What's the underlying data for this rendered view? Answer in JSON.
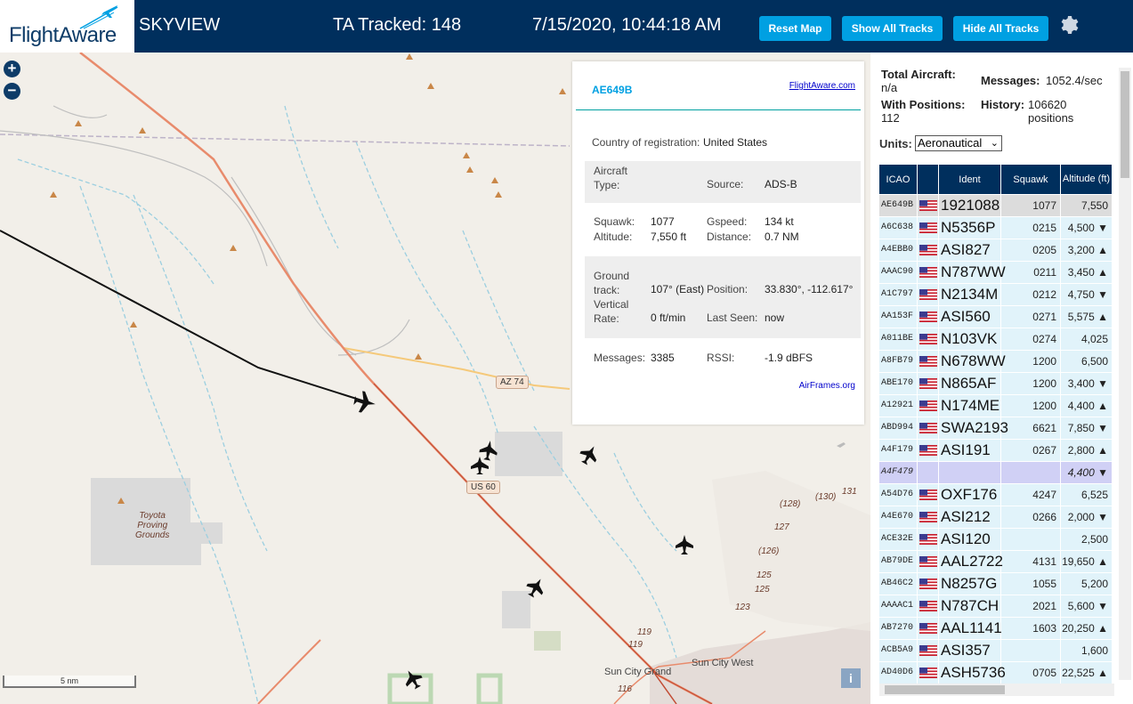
{
  "header": {
    "logo_text": "FlightAware",
    "app_name": "SKYVIEW",
    "ta_tracked": "TA Tracked: 148",
    "datetime": "7/15/2020, 10:44:18 AM",
    "buttons": {
      "reset": "Reset Map",
      "show_all": "Show All Tracks",
      "hide_all": "Hide All Tracks"
    },
    "settings_icon": "gear-icon",
    "bg_color": "#002f5d",
    "button_color": "#00a0e2"
  },
  "map": {
    "zoom_in": "+",
    "zoom_out": "−",
    "road_labels": {
      "az74": "AZ 74",
      "us60": "US 60"
    },
    "place_labels": {
      "toyota": "Toyota\nProving\nGrounds",
      "sun_city_grand": "Sun City Grand",
      "sun_city_west": "Sun City West"
    },
    "route_numbers": [
      "(128)",
      "(130)",
      "131",
      "127",
      "(126)",
      "125",
      "125",
      "123",
      "119",
      "119",
      "116"
    ],
    "scale": "5 nm",
    "info_btn": "i"
  },
  "popup": {
    "hex": "AE649B",
    "fa_link": "FlightAware.com",
    "country_label": "Country of registration:",
    "country": "United States",
    "aircraft_type_label": "Aircraft\nType:",
    "source_label": "Source:",
    "source": "ADS-B",
    "squawk_label": "Squawk:",
    "squawk": "1077",
    "gspeed_label": "Gspeed:",
    "gspeed": "134 kt",
    "altitude_label": "Altitude:",
    "altitude": "7,550 ft",
    "distance_label": "Distance:",
    "distance": "0.7 NM",
    "track_label": "Ground\ntrack:",
    "track": "107° (East)",
    "position_label": "Position:",
    "position": "33.830°, -112.617°",
    "vrate_label": "Vertical\nRate:",
    "vrate": "0 ft/min",
    "lastseen_label": "Last Seen:",
    "lastseen": "now",
    "messages_label": "Messages:",
    "messages": "3385",
    "rssi_label": "RSSI:",
    "rssi": "-1.9 dBFS",
    "airframes": "AirFrames.org"
  },
  "sidebar": {
    "total_label": "Total Aircraft:",
    "total": "n/a",
    "messages_label": "Messages:",
    "messages": "1052.4/sec",
    "withpos_label": "With Positions:",
    "withpos": "112",
    "history_label": "History:",
    "history": "106620 positions",
    "units_label": "Units:",
    "units_value": "Aeronautical",
    "columns": {
      "icao": "ICAO",
      "ident": "Ident",
      "squawk": "Squawk",
      "altitude": "Altitude (ft)"
    },
    "rows": [
      {
        "icao": "AE649B",
        "ident": "1921088",
        "squawk": "1077",
        "alt": "7,550",
        "state": "sel"
      },
      {
        "icao": "A6C638",
        "ident": "N5356P",
        "squawk": "0215",
        "alt": "4,500 ▼",
        "state": ""
      },
      {
        "icao": "A4EBB0",
        "ident": "ASI827",
        "squawk": "0205",
        "alt": "3,200 ▲",
        "state": ""
      },
      {
        "icao": "AAAC90",
        "ident": "N787WW",
        "squawk": "0211",
        "alt": "3,450 ▲",
        "state": ""
      },
      {
        "icao": "A1C797",
        "ident": "N2134M",
        "squawk": "0212",
        "alt": "4,750 ▼",
        "state": ""
      },
      {
        "icao": "AA153F",
        "ident": "ASI560",
        "squawk": "0271",
        "alt": "5,575 ▲",
        "state": ""
      },
      {
        "icao": "A011BE",
        "ident": "N103VK",
        "squawk": "0274",
        "alt": "4,025",
        "state": ""
      },
      {
        "icao": "A8FB79",
        "ident": "N678WW",
        "squawk": "1200",
        "alt": "6,500",
        "state": ""
      },
      {
        "icao": "ABE170",
        "ident": "N865AF",
        "squawk": "1200",
        "alt": "3,400 ▼",
        "state": ""
      },
      {
        "icao": "A12921",
        "ident": "N174ME",
        "squawk": "1200",
        "alt": "4,400 ▲",
        "state": ""
      },
      {
        "icao": "ABD994",
        "ident": "SWA2193",
        "squawk": "6621",
        "alt": "7,850 ▼",
        "state": ""
      },
      {
        "icao": "A4F179",
        "ident": "ASI191",
        "squawk": "0267",
        "alt": "2,800 ▲",
        "state": ""
      },
      {
        "icao": "A4F479",
        "ident": "",
        "squawk": "",
        "alt": "4,400 ▼",
        "state": "nopos"
      },
      {
        "icao": "A54D76",
        "ident": "OXF176",
        "squawk": "4247",
        "alt": "6,525",
        "state": ""
      },
      {
        "icao": "A4E670",
        "ident": "ASI212",
        "squawk": "0266",
        "alt": "2,000 ▼",
        "state": ""
      },
      {
        "icao": "ACE32E",
        "ident": "ASI120",
        "squawk": "",
        "alt": "2,500",
        "state": ""
      },
      {
        "icao": "AB79DE",
        "ident": "AAL2722",
        "squawk": "4131",
        "alt": "19,650 ▲",
        "state": ""
      },
      {
        "icao": "AB46C2",
        "ident": "N8257G",
        "squawk": "1055",
        "alt": "5,200",
        "state": ""
      },
      {
        "icao": "AAAAC1",
        "ident": "N787CH",
        "squawk": "2021",
        "alt": "5,600 ▼",
        "state": ""
      },
      {
        "icao": "AB7270",
        "ident": "AAL1141",
        "squawk": "1603",
        "alt": "20,250 ▲",
        "state": ""
      },
      {
        "icao": "ACB5A9",
        "ident": "ASI357",
        "squawk": "",
        "alt": "1,600",
        "state": ""
      },
      {
        "icao": "AD40D6",
        "ident": "ASH5736",
        "squawk": "0705",
        "alt": "22,525 ▲",
        "state": ""
      }
    ]
  }
}
